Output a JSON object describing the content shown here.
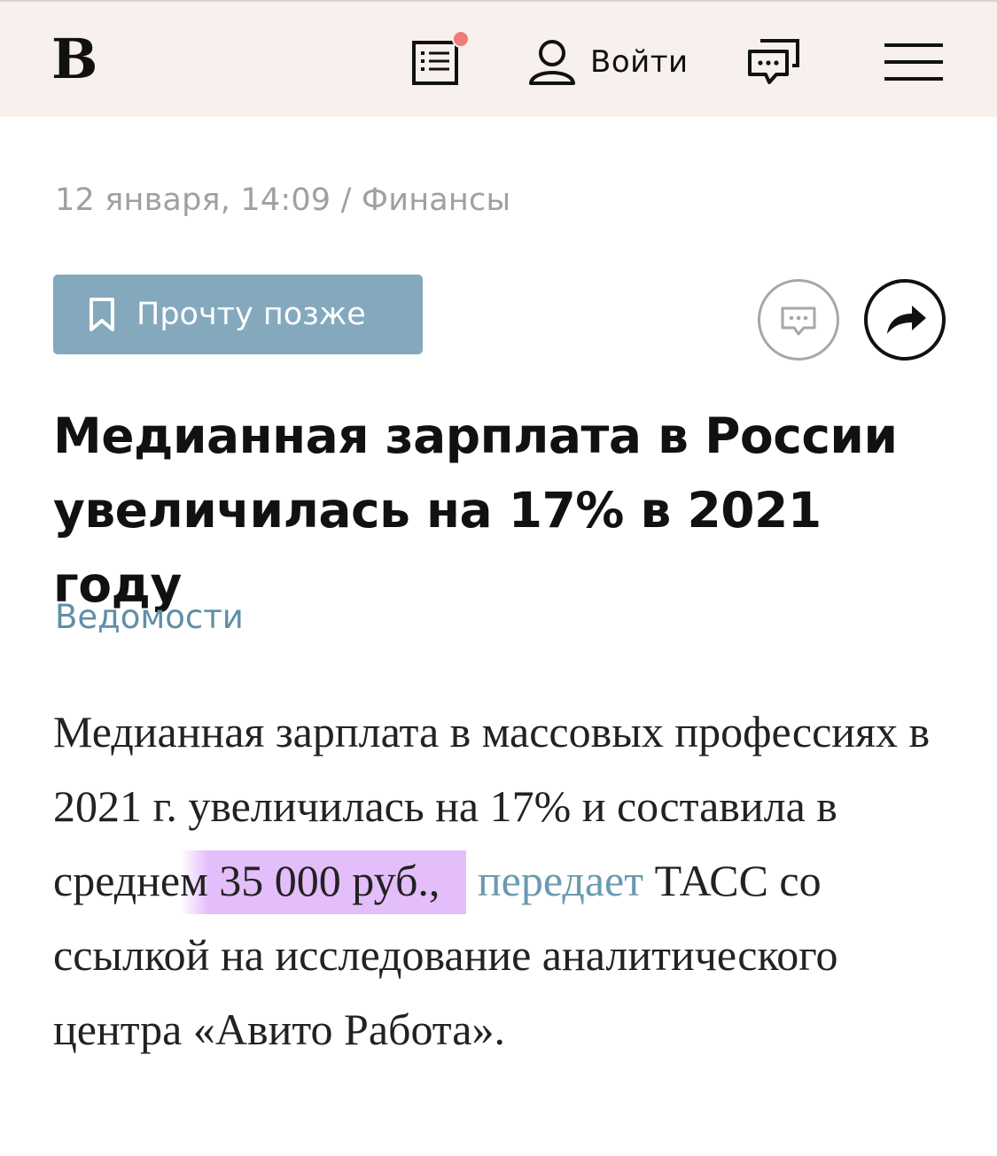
{
  "header": {
    "logo": "В",
    "login_label": "Войти",
    "news_has_badge": true,
    "badge_color": "#ef7b7b",
    "icons": [
      "news-list-icon",
      "user-icon",
      "comments-icon",
      "menu-icon"
    ]
  },
  "meta": {
    "date": "12 января, 14:09",
    "separator": "/",
    "rubric": "Финансы"
  },
  "actions": {
    "read_later_label": "Прочту позже",
    "read_later_color": "#84a9bd"
  },
  "article": {
    "title": "Медианная зарплата в России увеличилась на 17% в 2021 году",
    "source": "Ведомости",
    "body": {
      "part1": "Медианная зарплата в массовых профессиях в 2021 г. увеличилась на 17% и составила в средне",
      "part2": "м",
      "part3": " 35 000 руб.,",
      "link_text": "передает",
      "part4": " ТАСС со ссылкой на исследование аналитического центра «Авито Работа»."
    },
    "highlight_color": "#dba8fa"
  }
}
